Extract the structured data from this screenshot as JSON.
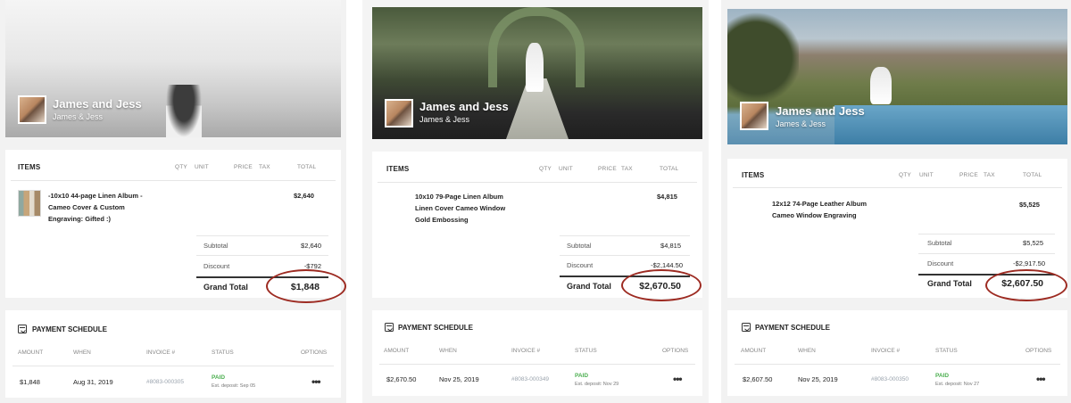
{
  "panels": [
    {
      "hero": {
        "title": "James and Jess",
        "subtitle": "James & Jess"
      },
      "items": {
        "heading": "ITEMS",
        "columns": [
          "QTY",
          "UNIT",
          "PRICE",
          "TAX",
          "TOTAL"
        ],
        "line": [
          "-10x10 44-page Linen Album -",
          "Cameo Cover & Custom",
          "Engraving: Gifted :)"
        ],
        "line_total": "$2,640",
        "subtotal_label": "Subtotal",
        "subtotal": "$2,640",
        "discount_label": "Discount",
        "discount": "-$792",
        "grand_label": "Grand Total",
        "grand": "$1,848"
      },
      "payment": {
        "heading": "PAYMENT SCHEDULE",
        "columns": [
          "AMOUNT",
          "WHEN",
          "INVOICE #",
          "STATUS",
          "OPTIONS"
        ],
        "amount": "$1,848",
        "when": "Aug 31, 2019",
        "invoice": "#8083-000305",
        "status": "PAID",
        "deposit": "Est. deposit: Sep 05",
        "options": "•••"
      }
    },
    {
      "hero": {
        "title": "James and Jess",
        "subtitle": "James & Jess"
      },
      "items": {
        "heading": "ITEMS",
        "columns": [
          "QTY",
          "UNIT",
          "PRICE",
          "TAX",
          "TOTAL"
        ],
        "line": [
          "10x10 79-Page Linen Album",
          "Linen Cover Cameo Window",
          "Gold Embossing"
        ],
        "line_total": "$4,815",
        "subtotal_label": "Subtotal",
        "subtotal": "$4,815",
        "discount_label": "Discount",
        "discount": "-$2,144.50",
        "grand_label": "Grand Total",
        "grand": "$2,670.50"
      },
      "payment": {
        "heading": "PAYMENT SCHEDULE",
        "columns": [
          "AMOUNT",
          "WHEN",
          "INVOICE #",
          "STATUS",
          "OPTIONS"
        ],
        "amount": "$2,670.50",
        "when": "Nov 25, 2019",
        "invoice": "#8083-000349",
        "status": "PAID",
        "deposit": "Est. deposit: Nov 29",
        "options": "•••"
      }
    },
    {
      "hero": {
        "title": "James and Jess",
        "subtitle": "James & Jess"
      },
      "items": {
        "heading": "ITEMS",
        "columns": [
          "QTY",
          "UNIT",
          "PRICE",
          "TAX",
          "TOTAL"
        ],
        "line": [
          "12x12 74-Page Leather Album",
          "Cameo Window Engraving"
        ],
        "line_total": "$5,525",
        "subtotal_label": "Subtotal",
        "subtotal": "$5,525",
        "discount_label": "Discount",
        "discount": "-$2,917.50",
        "grand_label": "Grand Total",
        "grand": "$2,607.50"
      },
      "payment": {
        "heading": "PAYMENT SCHEDULE",
        "columns": [
          "AMOUNT",
          "WHEN",
          "INVOICE #",
          "STATUS",
          "OPTIONS"
        ],
        "amount": "$2,607.50",
        "when": "Nov 25, 2019",
        "invoice": "#8083-000350",
        "status": "PAID",
        "deposit": "Est. deposit: Nov 27",
        "options": "•••"
      }
    }
  ],
  "colors": {
    "highlight_ring": "#9d2b22",
    "paid_green": "#4caf50",
    "invoice_gray": "#9aa3ad"
  }
}
